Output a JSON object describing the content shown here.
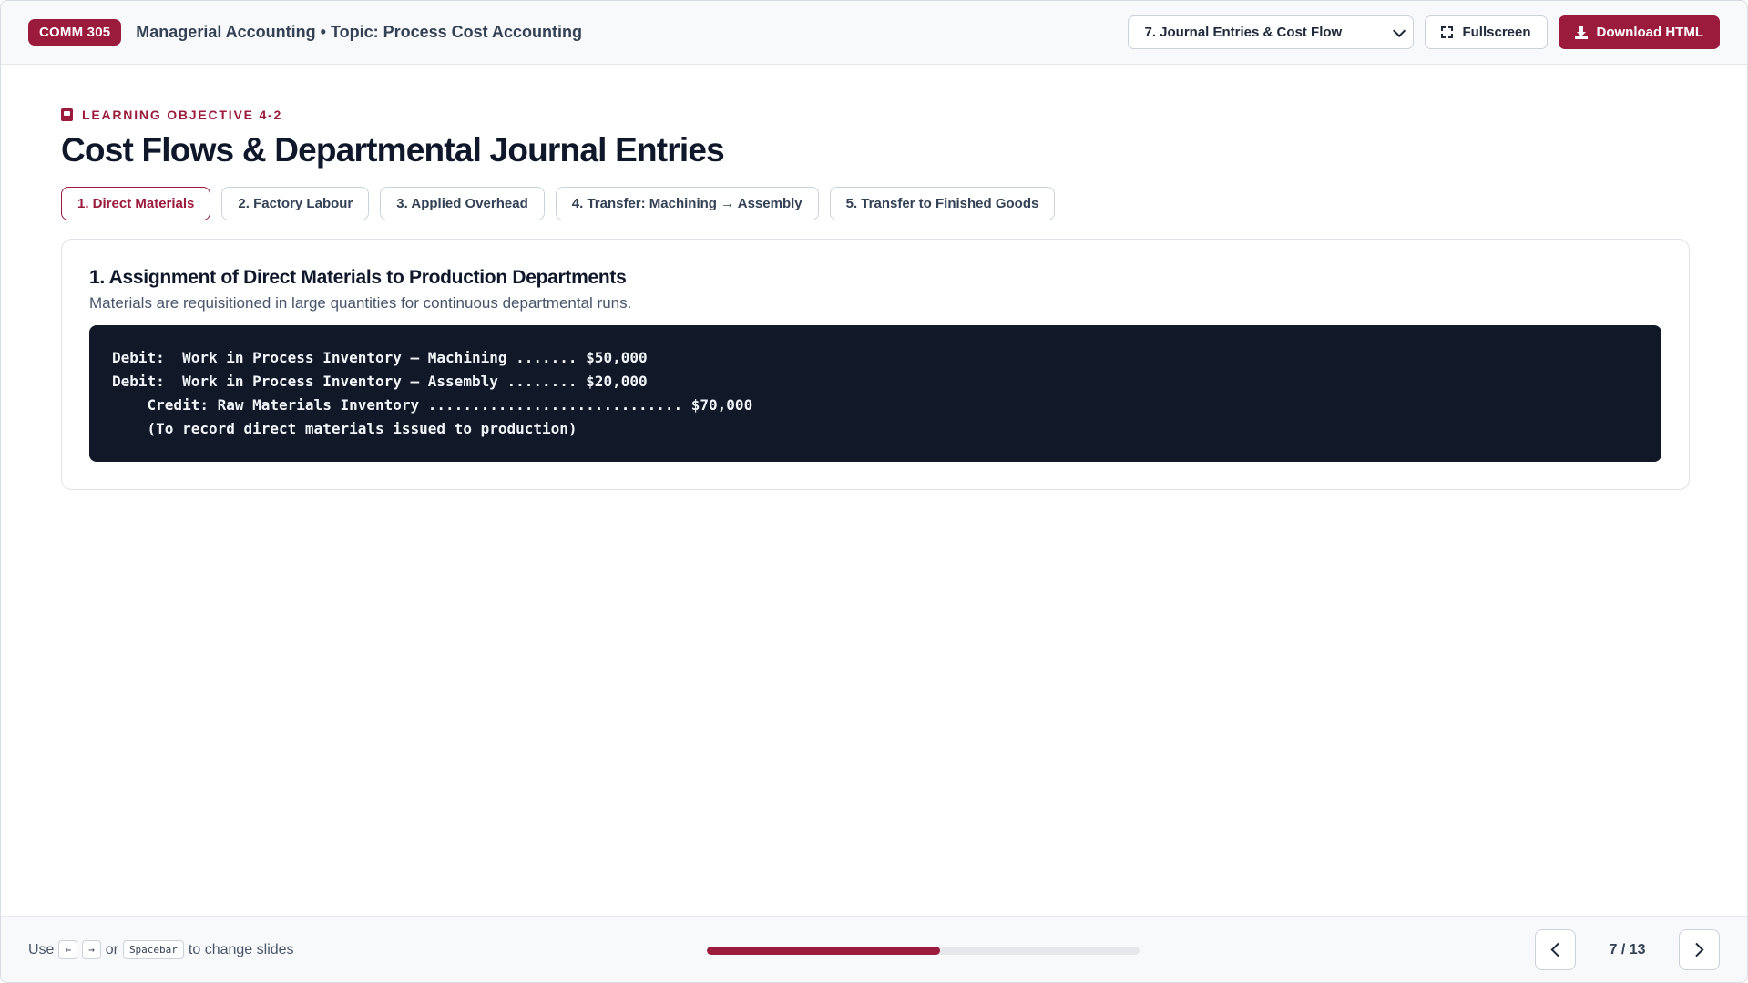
{
  "header": {
    "course_code": "COMM 305",
    "breadcrumb": "Managerial Accounting • Topic: Process Cost Accounting",
    "slide_select_value": "7. Journal Entries & Cost Flow",
    "fullscreen_label": "Fullscreen",
    "download_label": "Download HTML"
  },
  "main": {
    "objective": "LEARNING OBJECTIVE 4-2",
    "title": "Cost Flows & Departmental Journal Entries",
    "tabs": [
      {
        "label": "1. Direct Materials",
        "active": true
      },
      {
        "label": "2. Factory Labour",
        "active": false
      },
      {
        "label": "3. Applied Overhead",
        "active": false
      },
      {
        "label": "4. Transfer: Machining → Assembly",
        "active": false
      },
      {
        "label": "5. Transfer to Finished Goods",
        "active": false
      }
    ],
    "card": {
      "title": "1. Assignment of Direct Materials to Production Departments",
      "subtitle": "Materials are requisitioned in large quantities for continuous departmental runs.",
      "journal": "Debit:  Work in Process Inventory — Machining ....... $50,000\nDebit:  Work in Process Inventory — Assembly ........ $20,000\n    Credit: Raw Materials Inventory ............................. $70,000\n    (To record direct materials issued to production)"
    }
  },
  "footer": {
    "hint_use": "Use",
    "key_left": "←",
    "key_right": "→",
    "hint_or": "or",
    "key_space": "Spacebar",
    "hint_end": "to change slides",
    "progress_fraction": 0.538,
    "page_indicator": "7 / 13"
  },
  "colors": {
    "accent": "#9b1b3c",
    "code_bg": "#111827"
  }
}
